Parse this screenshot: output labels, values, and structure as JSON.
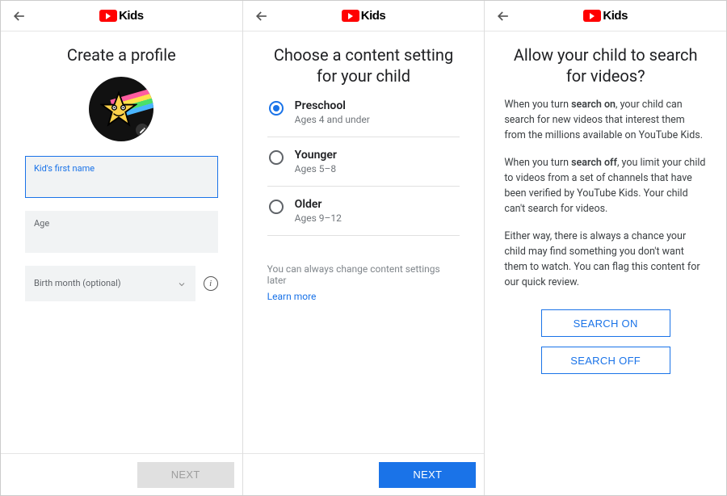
{
  "brand": {
    "name": "Kids"
  },
  "panel1": {
    "title": "Create a profile",
    "fields": {
      "firstName": {
        "label": "Kid's first name",
        "value": ""
      },
      "age": {
        "label": "Age",
        "value": ""
      },
      "birthMonth": {
        "label": "Birth month (optional)",
        "value": ""
      }
    },
    "nextLabel": "NEXT",
    "nextEnabled": false
  },
  "panel2": {
    "title": "Choose a content setting for your child",
    "options": [
      {
        "title": "Preschool",
        "sub": "Ages 4 and under",
        "selected": true
      },
      {
        "title": "Younger",
        "sub": "Ages 5–8",
        "selected": false
      },
      {
        "title": "Older",
        "sub": "Ages 9–12",
        "selected": false
      }
    ],
    "hint": "You can always change content settings later",
    "learnMore": "Learn more",
    "nextLabel": "NEXT",
    "nextEnabled": true
  },
  "panel3": {
    "title": "Allow your child to search for videos?",
    "para1_a": "When you turn ",
    "para1_b": "search on",
    "para1_c": ", your child can search for new videos that interest them from the millions available on YouTube Kids.",
    "para2_a": "When you turn ",
    "para2_b": "search off",
    "para2_c": ", you limit your child to videos from a set of channels that have been verified by YouTube Kids. Your child can't search for videos.",
    "para3": "Either way, there is always a chance your child may find something you don't want them to watch. You can flag this content for our quick review.",
    "searchOn": "SEARCH ON",
    "searchOff": "SEARCH OFF"
  }
}
